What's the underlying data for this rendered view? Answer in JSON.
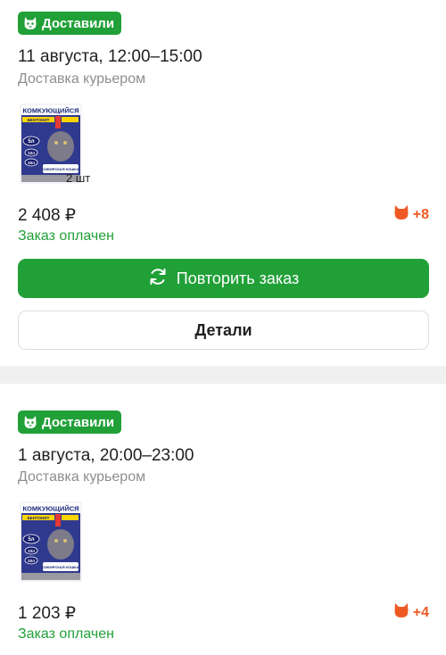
{
  "orders": [
    {
      "badge": "Доставили",
      "date": "11 августа, 12:00–15:00",
      "method": "Доставка курьером",
      "product": {
        "brand_text": "КОМКУЮЩИЙСЯ",
        "sub_text": "БЕНТОНИТ",
        "size_labels": [
          "5л",
          "10л",
          "20л"
        ],
        "line_text": "СИБИРСКАЯ КОШКА"
      },
      "qty": "2 шт",
      "price": "2 408 ₽",
      "status": "Заказ оплачен",
      "bonus": "+8",
      "repeat_label": "Повторить заказ",
      "details_label": "Детали"
    },
    {
      "badge": "Доставили",
      "date": "1 августа, 20:00–23:00",
      "method": "Доставка курьером",
      "product": {
        "brand_text": "КОМКУЮЩИЙСЯ",
        "sub_text": "БЕНТОНИТ",
        "size_labels": [
          "5л",
          "10л",
          "20л"
        ],
        "line_text": "СИБИРСКАЯ КОШКА"
      },
      "price": "1 203 ₽",
      "status": "Заказ оплачен",
      "bonus": "+4"
    }
  ],
  "colors": {
    "accent": "#21a038",
    "bonus": "#ef5a24",
    "muted": "#8e8e8e"
  },
  "icons": {
    "badge": "cat-face-icon",
    "bonus": "cat-head-icon",
    "repeat": "refresh-icon"
  }
}
